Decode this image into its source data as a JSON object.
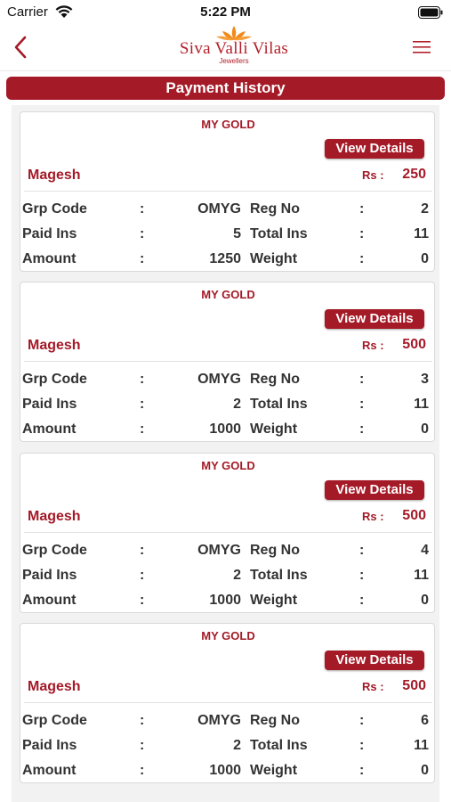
{
  "status_bar": {
    "carrier": "Carrier",
    "time": "5:22 PM"
  },
  "header": {
    "logo_name": "Siva Valli Vilas",
    "logo_sub": "Jewellers"
  },
  "page_title": "Payment History",
  "labels": {
    "scheme": "MY GOLD",
    "view_details": "View Details",
    "rs": "Rs :",
    "colon": ":",
    "grp_code": "Grp Code",
    "reg_no": "Reg No",
    "paid_ins": "Paid Ins",
    "total_ins": "Total Ins",
    "amount": "Amount",
    "weight": "Weight"
  },
  "colors": {
    "brand": "#a41a27",
    "accent": "#f08a1c"
  },
  "cards": [
    {
      "name": "Magesh",
      "rs": "250",
      "grp_code": "OMYG",
      "reg_no": "2",
      "paid_ins": "5",
      "total_ins": "11",
      "amount": "1250",
      "weight": "0"
    },
    {
      "name": "Magesh",
      "rs": "500",
      "grp_code": "OMYG",
      "reg_no": "3",
      "paid_ins": "2",
      "total_ins": "11",
      "amount": "1000",
      "weight": "0"
    },
    {
      "name": "Magesh",
      "rs": "500",
      "grp_code": "OMYG",
      "reg_no": "4",
      "paid_ins": "2",
      "total_ins": "11",
      "amount": "1000",
      "weight": "0"
    },
    {
      "name": "Magesh",
      "rs": "500",
      "grp_code": "OMYG",
      "reg_no": "6",
      "paid_ins": "2",
      "total_ins": "11",
      "amount": "1000",
      "weight": "0"
    }
  ]
}
